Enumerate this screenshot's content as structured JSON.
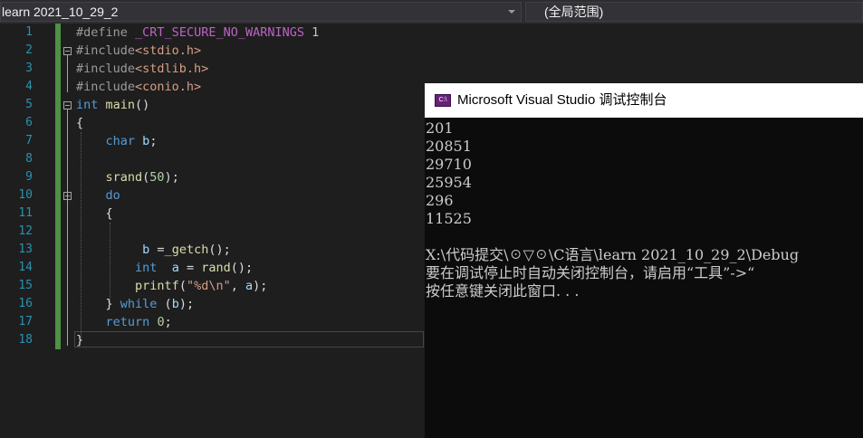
{
  "nav": {
    "file_combo": "learn 2021_10_29_2",
    "scope_combo": "(全局范围)"
  },
  "editor": {
    "line_numbers": [
      "1",
      "2",
      "3",
      "4",
      "5",
      "6",
      "7",
      "8",
      "9",
      "10",
      "11",
      "12",
      "13",
      "14",
      "15",
      "16",
      "17",
      "18"
    ],
    "lines": {
      "l1_define": "#define",
      "l1_macro": "_CRT_SECURE_NO_WARNINGS",
      "l1_val": "1",
      "l2_inc": "#include",
      "l2_hdr": "<stdio.h>",
      "l3_inc": "#include",
      "l3_hdr": "<stdlib.h>",
      "l4_inc": "#include",
      "l4_hdr": "<conio.h>",
      "l5_kw": "int",
      "l5_fn": "main",
      "l5_rest": "()",
      "l6": "{",
      "l7_kw": "char",
      "l7_var": "b",
      "l7_rest": ";",
      "l9_fn": "srand",
      "l9_open": "(",
      "l9_num": "50",
      "l9_close": ");",
      "l10_kw": "do",
      "l11": "{",
      "l13_var": "b",
      "l13_op": " =",
      "l13_fn": "_getch",
      "l13_rest": "();",
      "l14_kw": "int",
      "l14_var": "a",
      "l14_op": " = ",
      "l14_fn": "rand",
      "l14_rest": "();",
      "l15_fn": "printf",
      "l15_open": "(",
      "l15_str": "\"%d\\n\"",
      "l15_comma": ", ",
      "l15_var": "a",
      "l15_close": ");",
      "l16_brace": "} ",
      "l16_kw": "while",
      "l16_open": " (",
      "l16_var": "b",
      "l16_close": ");",
      "l17_kw": "return",
      "l17_num": "0",
      "l17_rest": ";",
      "l18": "}"
    }
  },
  "console": {
    "title": "Microsoft Visual Studio 调试控制台",
    "icon_label": "C:\\",
    "output": [
      "201",
      "20851",
      "29710",
      "25954",
      "296",
      "11525",
      "",
      "X:\\代码提交\\☉▽☉\\C语言\\learn 2021_10_29_2\\Debug",
      "要在调试停止时自动关闭控制台，请启用“工具”->“",
      "按任意键关闭此窗口. . ."
    ]
  },
  "colors": {
    "keyword": "#569cd6",
    "function": "#dcdcaa",
    "string": "#d69d85",
    "number": "#b5cea8",
    "variable": "#9cdcfe",
    "macro": "#bd63c5",
    "line_number": "#2b91af",
    "change_bar": "#57a64a"
  }
}
